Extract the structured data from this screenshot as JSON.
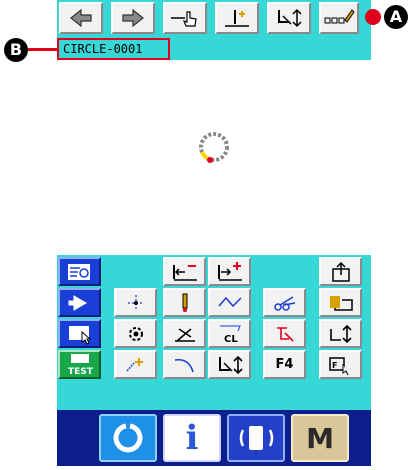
{
  "toolbar": {
    "buttons": [
      {
        "name": "arrow-back-button",
        "icon": "arrow-left-icon"
      },
      {
        "name": "arrow-forward-button",
        "icon": "arrow-right-icon"
      },
      {
        "name": "pointer-button",
        "icon": "hand-pointer-icon"
      },
      {
        "name": "move-button",
        "icon": "needle-move-icon"
      },
      {
        "name": "feed-button",
        "icon": "presser-foot-icon"
      },
      {
        "name": "name-edit-button",
        "icon": "pencil-text-icon"
      }
    ]
  },
  "pattern": {
    "name": "CIRCLE-0001"
  },
  "callouts": {
    "a": "A",
    "b": "B"
  },
  "function_grid": {
    "f4_label": "F4",
    "test_label": "TEST"
  },
  "bottom_bar": {
    "info_label": "i",
    "memory_label": "M"
  },
  "colors": {
    "accent": "#37d7d7",
    "navy": "#0b1e8c",
    "callout": "#e0001b"
  }
}
